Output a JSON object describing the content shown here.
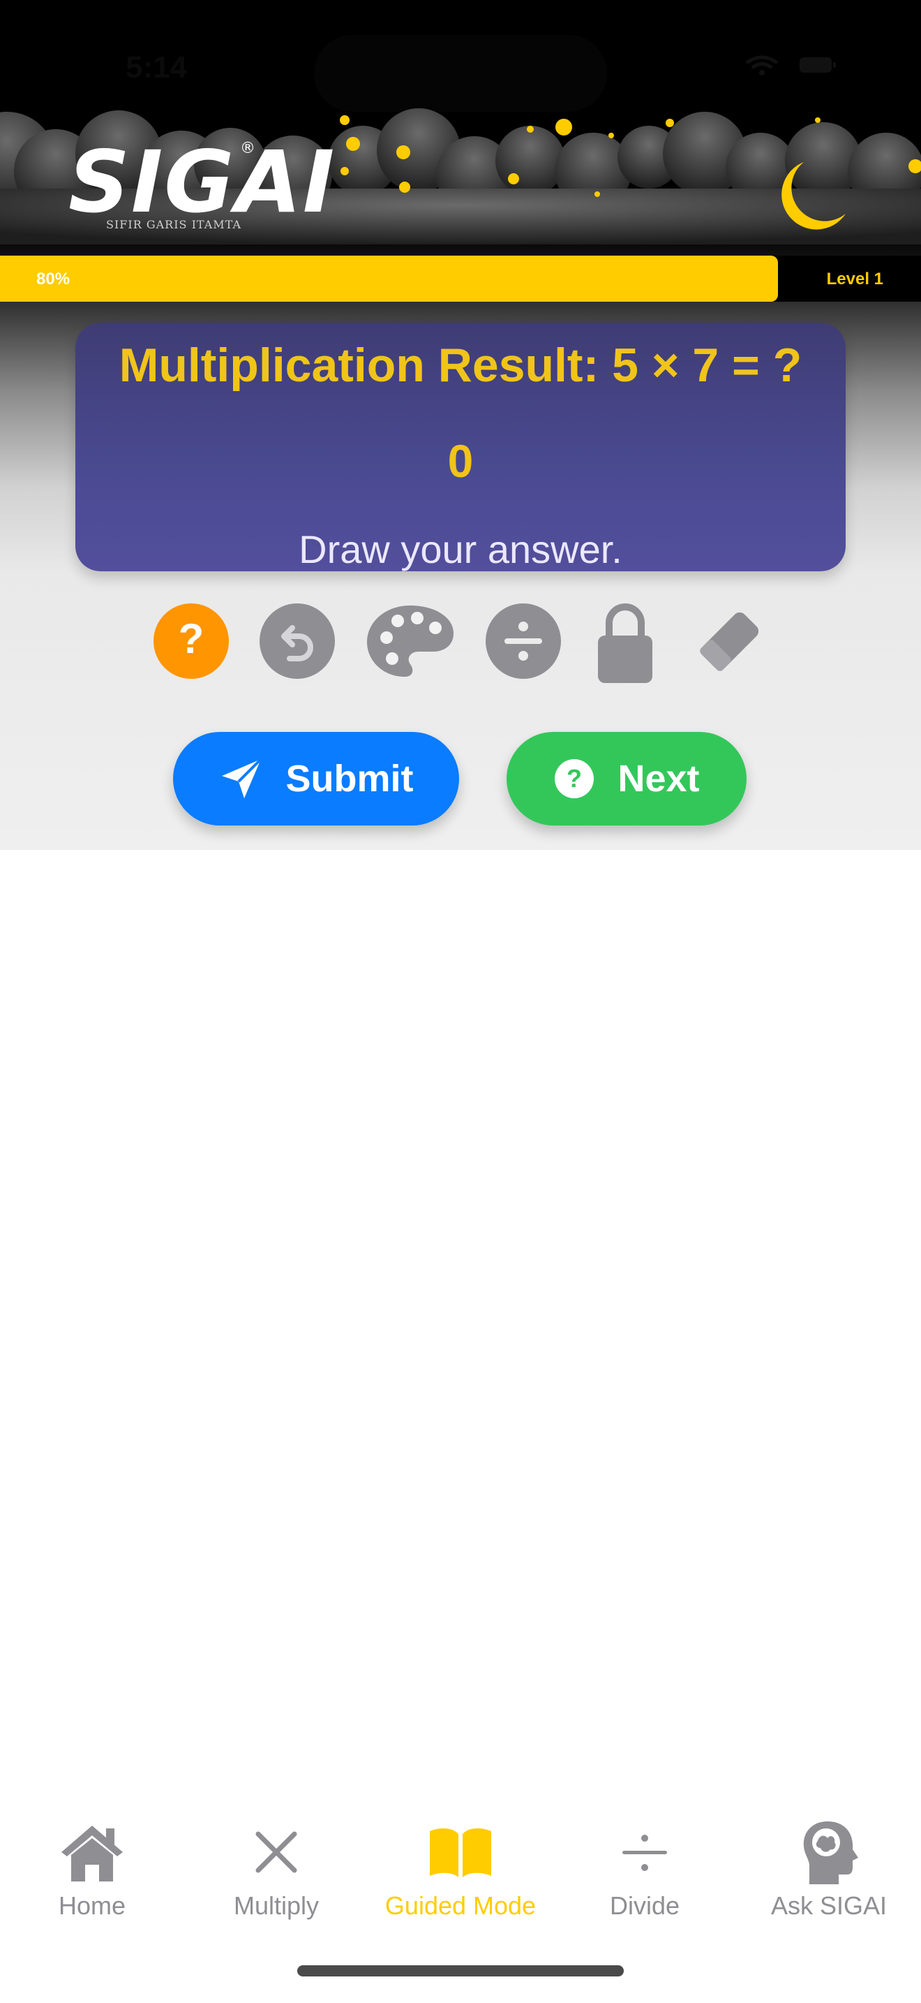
{
  "status_bar": {
    "time": "5:14"
  },
  "header": {
    "logo_text": "SIGAI",
    "logo_registered": "®",
    "logo_tagline": "SIFIR GARIS ITAMTA"
  },
  "progress": {
    "percent_label": "80%",
    "fraction": 0.8,
    "level_label": "Level 1"
  },
  "question_card": {
    "question": "Multiplication Result: 5 × 7 = ?",
    "answer": "0",
    "instruction": "Draw your answer."
  },
  "toolbar": {
    "tools": [
      "hint-icon",
      "undo-icon",
      "palette-icon",
      "divide-icon",
      "lock-icon",
      "eraser-icon"
    ],
    "hint_label": "?"
  },
  "actions": {
    "submit_label": "Submit",
    "next_label": "Next"
  },
  "tab_bar": {
    "items": [
      {
        "label": "Home",
        "icon": "home-icon"
      },
      {
        "label": "Multiply",
        "icon": "multiply-icon"
      },
      {
        "label": "Guided Mode",
        "icon": "book-icon",
        "active": true
      },
      {
        "label": "Divide",
        "icon": "divide-icon"
      },
      {
        "label": "Ask SIGAI",
        "icon": "brain-head-icon"
      }
    ]
  },
  "colors": {
    "accent_yellow": "#ffcc00",
    "submit_blue": "#0a7cff",
    "next_green": "#33c75a",
    "hint_orange": "#ff9500",
    "icon_gray": "#8e8e93",
    "card_purple": "#4a4a92",
    "question_gold": "#f0c419"
  }
}
